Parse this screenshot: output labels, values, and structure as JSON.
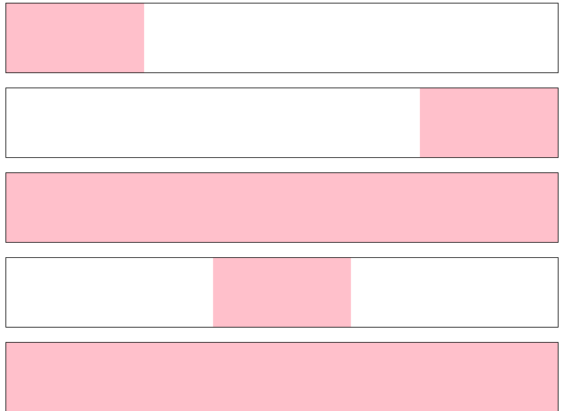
{
  "colors": {
    "fill": "#ffc0cb",
    "border": "#000000",
    "background": "#ffffff"
  },
  "boxes": [
    {
      "fill_start": 0.0,
      "fill_fraction": 0.25
    },
    {
      "fill_start": 0.75,
      "fill_fraction": 0.25
    },
    {
      "fill_start": 0.0,
      "fill_fraction": 1.0
    },
    {
      "fill_start": 0.375,
      "fill_fraction": 0.25
    },
    {
      "fill_start": 0.0,
      "fill_fraction": 1.0
    }
  ]
}
